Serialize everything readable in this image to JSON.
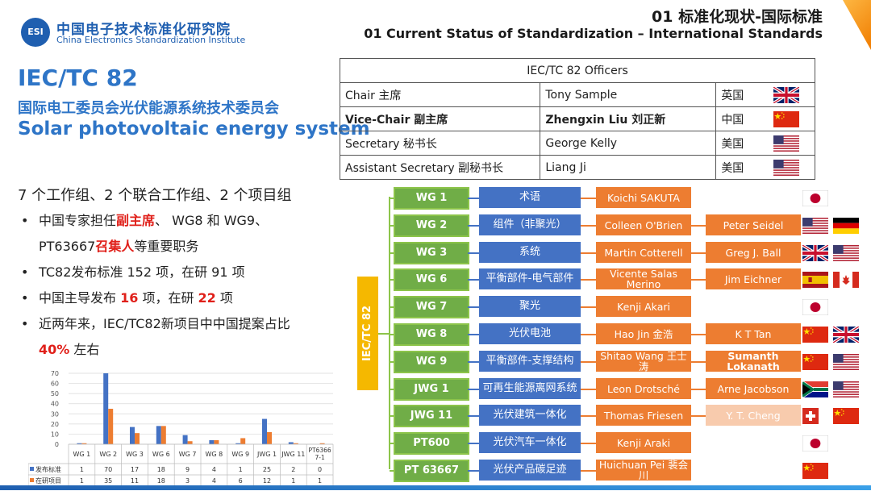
{
  "header": {
    "logo_mark": "ESI",
    "org_cn": "中国电子技术标准化研究院",
    "org_en": "China Electronics Standardization Institute",
    "title_cn": "01 标准化现状-国际标准",
    "title_en": "01 Current Status of Standardization – International Standards"
  },
  "left": {
    "tc_title": "IEC/TC 82",
    "tc_cn": "国际电工委员会光伏能源系统技术委员会",
    "tc_en": "Solar photovoltaic energy system",
    "summary": "7 个工作组、2 个联合工作组、2 个项目组",
    "bullets": [
      {
        "a": "中国专家担任",
        "b": "副主席",
        "c": "、 WG8 和 WG9、"
      },
      {
        "a": "PT63667",
        "b": "召集人",
        "c": "等重要职务"
      },
      {
        "a": "TC82发布标准 152 项，在研 91 项",
        "b": "",
        "c": ""
      },
      {
        "a": "中国主导发布 ",
        "b": "16",
        "c": " 项，在研 ",
        "d": "22",
        "e": " 项"
      },
      {
        "a": "近两年来，IEC/TC82新项目中中国提案占比",
        "b": "",
        "c": ""
      },
      {
        "a": "",
        "b": "40%",
        "c": " 左右"
      }
    ]
  },
  "officers": {
    "heading": "IEC/TC 82 Officers",
    "rows": [
      {
        "role": "Chair 主席",
        "name": "Tony Sample",
        "country": "英国",
        "flag": "uk",
        "bold": false
      },
      {
        "role": "Vice-Chair 副主席",
        "name": "Zhengxin Liu 刘正新",
        "country": "中国",
        "flag": "cn",
        "bold": true
      },
      {
        "role": "Secretary 秘书长",
        "name": "George Kelly",
        "country": "美国",
        "flag": "us",
        "bold": false
      },
      {
        "role": "Assistant Secretary 副秘书长",
        "name": "Liang Ji",
        "country": "美国",
        "flag": "us",
        "bold": false
      }
    ]
  },
  "org": {
    "tc_label": "IEC/TC 82",
    "rows": [
      {
        "wg": "WG 1",
        "topic": "术语",
        "p1": "Koichi SAKUTA",
        "p2": "",
        "flags": [
          "jp"
        ]
      },
      {
        "wg": "WG 2",
        "topic": "组件（非聚光）",
        "p1": "Colleen O'Brien",
        "p2": "Peter Seidel",
        "flags": [
          "us",
          "de"
        ]
      },
      {
        "wg": "WG 3",
        "topic": "系统",
        "p1": "Martin Cotterell",
        "p2": "Greg J. Ball",
        "flags": [
          "uk",
          "us"
        ]
      },
      {
        "wg": "WG 6",
        "topic": "平衡部件-电气部件",
        "p1": "Vicente Salas Merino",
        "p2": "Jim Eichner",
        "flags": [
          "es",
          "ca"
        ]
      },
      {
        "wg": "WG 7",
        "topic": "聚光",
        "p1": "Kenji Akari",
        "p2": "",
        "flags": [
          "jp"
        ]
      },
      {
        "wg": "WG 8",
        "topic": "光伏电池",
        "p1": "Hao Jin 金浩",
        "p2": "K T Tan",
        "flags": [
          "cn",
          "uk"
        ]
      },
      {
        "wg": "WG 9",
        "topic": "平衡部件-支撑结构",
        "p1": "Shitao Wang 王士涛",
        "p2": "Sumanth Lokanath",
        "flags": [
          "cn",
          "us"
        ]
      },
      {
        "wg": "JWG 1",
        "topic": "可再生能源离网系统",
        "p1": "Leon Drotsché",
        "p2": "Arne Jacobson",
        "flags": [
          "za",
          "us"
        ]
      },
      {
        "wg": "JWG 11",
        "topic": "光伏建筑一体化",
        "p1": "Thomas Friesen",
        "p2": "Y. T. Cheng",
        "flags": [
          "ch",
          "cn"
        ]
      },
      {
        "wg": "PT600",
        "topic": "光伏汽车一体化",
        "p1": "Kenji Araki",
        "p2": "",
        "flags": [
          "jp"
        ]
      },
      {
        "wg": "PT 63667",
        "topic": "光伏产品碳足迹",
        "p1": "Huichuan Pei 裴会川",
        "p2": "",
        "flags": [
          "cn"
        ]
      }
    ]
  },
  "chart_data": {
    "type": "bar",
    "categories": [
      "WG 1",
      "WG 2",
      "WG 3",
      "WG 6",
      "WG 7",
      "WG 8",
      "WG 9",
      "JWG 1",
      "JWG 11",
      "PT63667-1"
    ],
    "category_labels": [
      "WG 1",
      "WG 2",
      "WG 3",
      "WG 6",
      "WG 7",
      "WG 8",
      "WG 9",
      "JWG 1",
      "JWG 11",
      "PT6366 7-1"
    ],
    "series": [
      {
        "name": "发布标准",
        "values": [
          1,
          70,
          17,
          18,
          9,
          4,
          1,
          25,
          2,
          0
        ],
        "color": "#4472c4"
      },
      {
        "name": "在研项目",
        "values": [
          1,
          35,
          11,
          18,
          3,
          4,
          6,
          12,
          1,
          1
        ],
        "color": "#ed7d31"
      }
    ],
    "ylim": [
      0,
      70
    ],
    "yticks": [
      0,
      10,
      20,
      30,
      40,
      50,
      60,
      70
    ],
    "grid": true,
    "legend": "data-table"
  },
  "colors": {
    "accent_blue": "#2e75c7",
    "wg_green": "#70ad47",
    "topic_blue": "#4472c4",
    "person_orange": "#ed7d31",
    "tc_yellow": "#f5b800",
    "highlight_red": "#e0201a"
  }
}
